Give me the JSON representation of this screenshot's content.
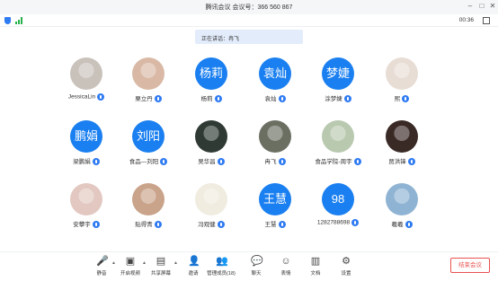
{
  "titlebar": {
    "title": "腾讯会议 会议号：366 560 867"
  },
  "statusbar": {
    "timer": "00:36"
  },
  "speaking": {
    "text": "正在讲话：冉飞"
  },
  "participants": [
    {
      "name": "JessicaLin",
      "avatar_text": "",
      "photo": true,
      "color": "#c9c2bb"
    },
    {
      "name": "栗立丹",
      "avatar_text": "",
      "photo": true,
      "color": "#d9b9a5"
    },
    {
      "name": "杨莉",
      "avatar_text": "杨莉",
      "photo": false
    },
    {
      "name": "袁灿",
      "avatar_text": "袁灿",
      "photo": false
    },
    {
      "name": "涂梦婕",
      "avatar_text": "梦婕",
      "photo": false
    },
    {
      "name": "熙",
      "avatar_text": "",
      "photo": true,
      "color": "#e8ddd5"
    },
    {
      "name": "梁鹏娟",
      "avatar_text": "鹏娟",
      "photo": false
    },
    {
      "name": "食品—刘阳",
      "avatar_text": "刘阳",
      "photo": false
    },
    {
      "name": "吴华昌",
      "avatar_text": "",
      "photo": true,
      "color": "#2f3a34"
    },
    {
      "name": "冉飞",
      "avatar_text": "",
      "photo": true,
      "color": "#6b6f62"
    },
    {
      "name": "食品学院-周宇",
      "avatar_text": "",
      "photo": true,
      "color": "#b9c9b0"
    },
    {
      "name": "贾洪锋",
      "avatar_text": "",
      "photo": true,
      "color": "#3a2a26"
    },
    {
      "name": "安攀宇",
      "avatar_text": "",
      "photo": true,
      "color": "#e2c8c0"
    },
    {
      "name": "贴得青",
      "avatar_text": "",
      "photo": true,
      "color": "#c9a38a"
    },
    {
      "name": "冯观健",
      "avatar_text": "",
      "photo": true,
      "color": "#f0ece0"
    },
    {
      "name": "王慧",
      "avatar_text": "王慧",
      "photo": false
    },
    {
      "name": "1282788698",
      "avatar_text": "98",
      "photo": false
    },
    {
      "name": "羲羲",
      "avatar_text": "",
      "photo": true,
      "color": "#8fb4d3"
    }
  ],
  "toolbar": {
    "items": [
      {
        "label": "静音",
        "icon": "mic-icon",
        "glyph": "🎤"
      },
      {
        "label": "开启视频",
        "icon": "video-off-icon",
        "glyph": "▣"
      },
      {
        "label": "共享屏幕",
        "icon": "share-screen-icon",
        "glyph": "▤"
      },
      {
        "label": "邀请",
        "icon": "invite-icon",
        "glyph": "👤"
      },
      {
        "label": "管理成员(18)",
        "icon": "members-icon",
        "glyph": "👥"
      },
      {
        "label": "聊天",
        "icon": "chat-icon",
        "glyph": "💬"
      },
      {
        "label": "表情",
        "icon": "emoji-icon",
        "glyph": "☺"
      },
      {
        "label": "文档",
        "icon": "document-icon",
        "glyph": "▥"
      },
      {
        "label": "设置",
        "icon": "settings-icon",
        "glyph": "⚙"
      }
    ],
    "end_label": "结束会议"
  }
}
